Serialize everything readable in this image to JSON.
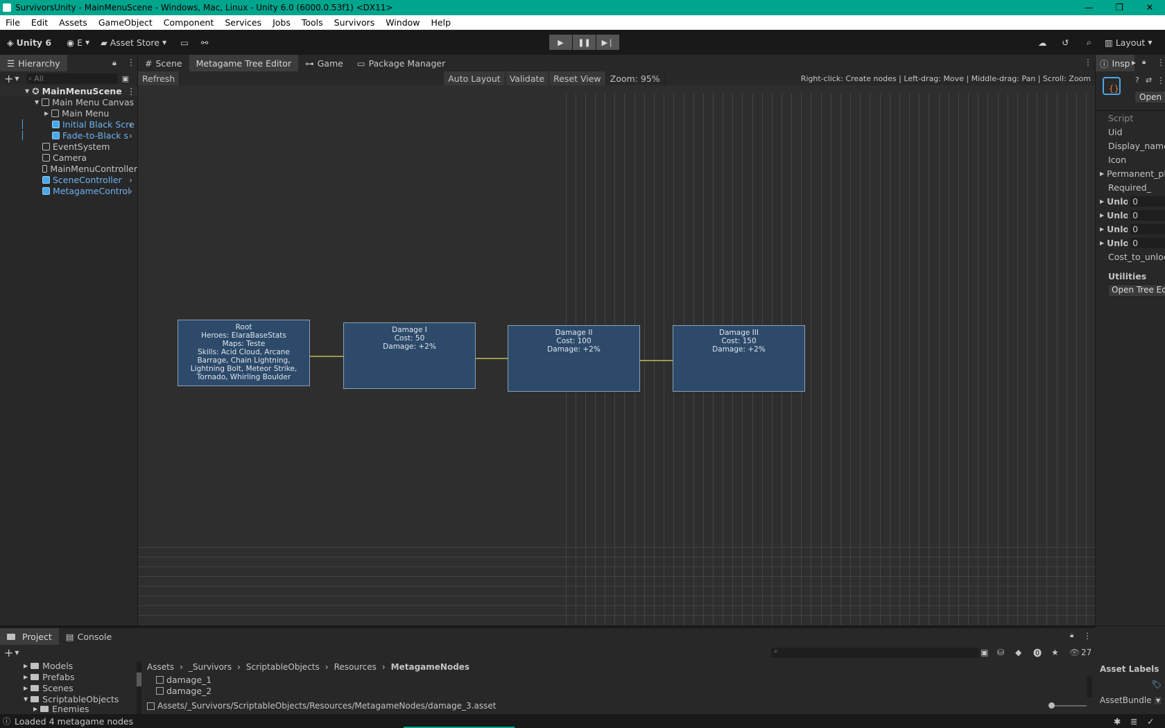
{
  "window": {
    "title": "SurvivorsUnity - MainMenuScene - Windows, Mac, Linux - Unity 6.0 (6000.0.53f1) <DX11>"
  },
  "menu": [
    "File",
    "Edit",
    "Assets",
    "GameObject",
    "Component",
    "Services",
    "Jobs",
    "Tools",
    "Survivors",
    "Window",
    "Help"
  ],
  "toolbar": {
    "unity_label": "Unity 6",
    "account_label": "E",
    "asset_store_label": "Asset Store",
    "layout_label": "Layout"
  },
  "hierarchy": {
    "tab_label": "Hierarchy",
    "search_placeholder": "All",
    "items": [
      {
        "label": "MainMenuScene"
      },
      {
        "label": "Main Menu Canvas"
      },
      {
        "label": "Main Menu"
      },
      {
        "label": "Initial Black Scre"
      },
      {
        "label": "Fade-to-Black s"
      },
      {
        "label": "EventSystem"
      },
      {
        "label": "Camera"
      },
      {
        "label": "MainMenuController"
      },
      {
        "label": "SceneController"
      },
      {
        "label": "MetagameControl"
      }
    ]
  },
  "editor": {
    "tabs": [
      "Scene",
      "Metagame Tree Editor",
      "Game",
      "Package Manager"
    ],
    "toolbar": {
      "refresh": "Refresh",
      "auto_layout": "Auto Layout",
      "validate": "Validate",
      "reset_view": "Reset View",
      "zoom": "Zoom: 95%"
    },
    "hint": "Right-click: Create nodes | Left-drag: Move | Middle-drag: Pan | Scroll: Zoom",
    "nodes": [
      {
        "lines": [
          "Root",
          "Heroes: ElaraBaseStats",
          "Maps: Teste",
          "Skills: Acid Cloud, Arcane Barrage, Chain Lightning, Lightning Bolt, Meteor Strike, Tornado, Whirling Boulder"
        ]
      },
      {
        "lines": [
          "Damage I",
          "Cost: 50",
          "Damage: +2%"
        ]
      },
      {
        "lines": [
          "Damage II",
          "Cost: 100",
          "Damage: +2%"
        ]
      },
      {
        "lines": [
          "Damage III",
          "Cost: 150",
          "Damage: +2%"
        ]
      }
    ]
  },
  "inspector": {
    "tab_label": "Insp",
    "open_label": "Open",
    "rows": [
      "Script",
      "Uid",
      "Display_name",
      "Icon",
      "Permanent_pla",
      "Required_",
      "Unlo",
      "Unlo",
      "Unlo",
      "Unlo",
      "Cost_to_unloc"
    ],
    "row_values": [
      "0",
      "0",
      "0",
      "0"
    ],
    "utilities_label": "Utilities",
    "open_tree_button": "Open Tree Ed",
    "asset_labels": "Asset Labels",
    "asset_bundle": "AssetBundle"
  },
  "project": {
    "tabs": [
      "Project",
      "Console"
    ],
    "folders": [
      "Models",
      "Prefabs",
      "Scenes",
      "ScriptableObjects",
      "Enemies"
    ],
    "breadcrumb": [
      "Assets",
      "_Survivors",
      "ScriptableObjects",
      "Resources",
      "MetagameNodes"
    ],
    "files": [
      "damage_1",
      "damage_2"
    ],
    "path": "Assets/_Survivors/ScriptableObjects/Resources/MetagameNodes/damage_3.asset",
    "count": "27"
  },
  "status": {
    "message": "Loaded 4 metagame nodes"
  }
}
